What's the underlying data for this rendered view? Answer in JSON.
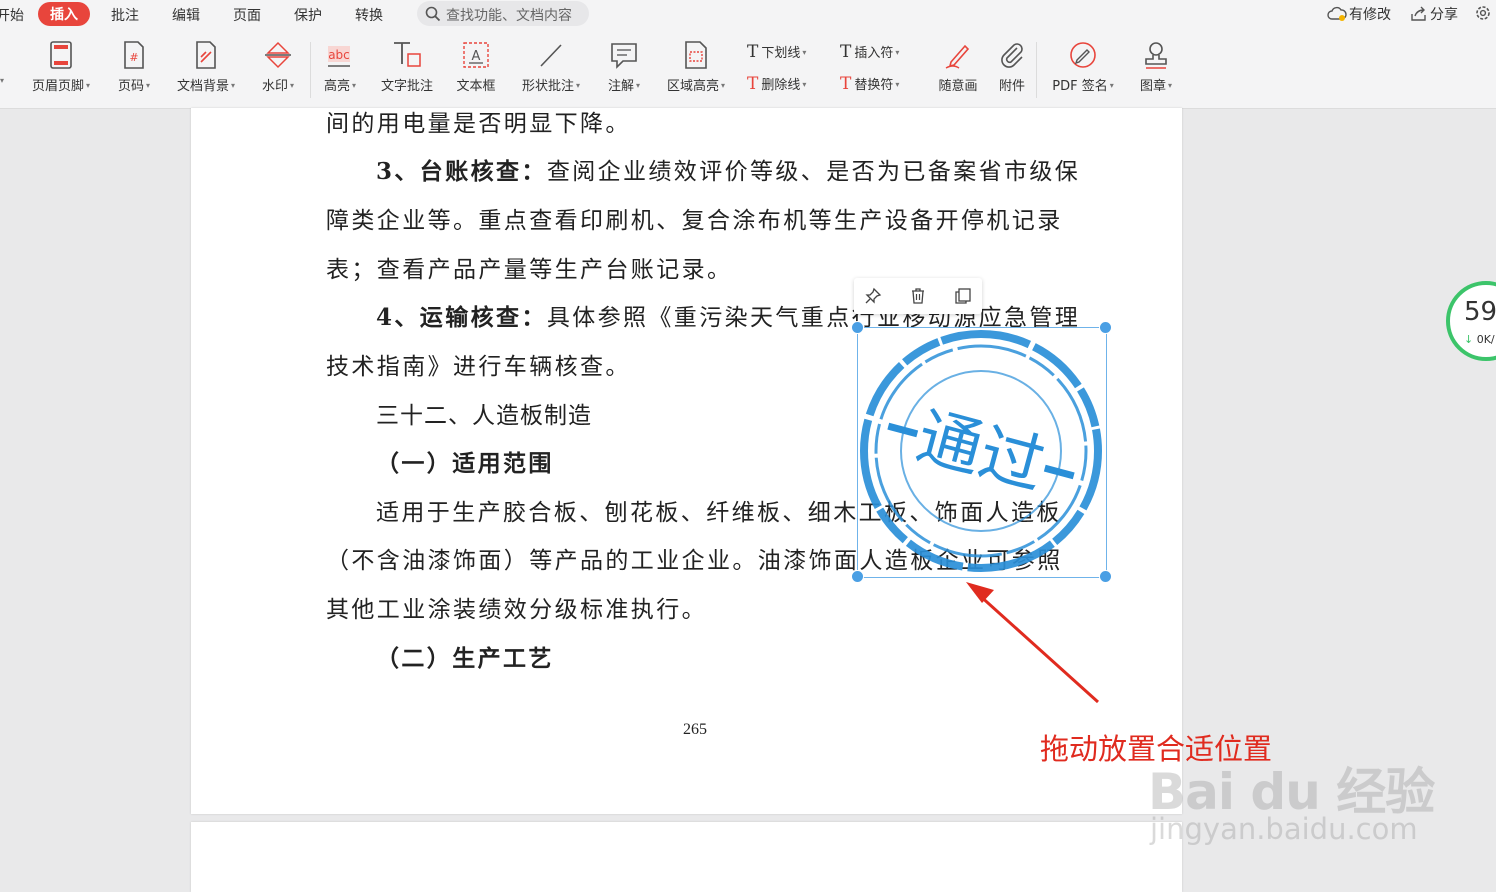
{
  "menu": {
    "items": [
      "开始",
      "插入",
      "批注",
      "编辑",
      "页面",
      "保护",
      "转换"
    ],
    "active": "插入",
    "search_placeholder": "查找功能、文档内容",
    "right": {
      "modified": "有修改",
      "share": "分享"
    }
  },
  "ribbon": {
    "tools": [
      {
        "label": "页眉页脚",
        "icon": "header-footer-icon"
      },
      {
        "label": "页码",
        "icon": "page-number-icon"
      },
      {
        "label": "文档背景",
        "icon": "doc-background-icon"
      },
      {
        "label": "水印",
        "icon": "watermark-icon"
      },
      {
        "label": "高亮",
        "icon": "highlight-icon"
      },
      {
        "label": "文字批注",
        "icon": "text-comment-icon"
      },
      {
        "label": "文本框",
        "icon": "textbox-icon"
      },
      {
        "label": "形状批注",
        "icon": "shape-comment-icon"
      },
      {
        "label": "注解",
        "icon": "annotation-icon"
      },
      {
        "label": "区域高亮",
        "icon": "area-highlight-icon"
      },
      {
        "label": "随意画",
        "icon": "freehand-icon"
      },
      {
        "label": "附件",
        "icon": "attachment-icon"
      },
      {
        "label": "PDF 签名",
        "icon": "pdf-sign-icon"
      },
      {
        "label": "图章",
        "icon": "stamp-icon"
      }
    ],
    "small_tools": {
      "underline": "下划线",
      "strikethrough": "删除线",
      "insert_mark": "插入符",
      "replace_mark": "替换符"
    }
  },
  "document": {
    "lines": {
      "l1": "间的用电量是否明显下降。",
      "l2_bold": "3、台账核查：",
      "l2_rest": "查阅企业绩效评价等级、是否为已备案省市级保",
      "l3": "障类企业等。重点查看印刷机、复合涂布机等生产设备开停机记录",
      "l4": "表；查看产品产量等生产台账记录。",
      "l5_bold": "4、运输核查：",
      "l5_rest": "具体参照《重污染天气重点行业移动源应急管理",
      "l6": "技术指南》进行车辆核查。",
      "l7": "三十二、人造板制造",
      "l8": "（一）适用范围",
      "l9": "适用于生产胶合板、刨花板、纤维板、细木工板、饰面人造板",
      "l10": "（不含油漆饰面）等产品的工业企业。油漆饰面人造板企业可参照",
      "l11": "其他工业涂装绩效分级标准执行。",
      "l12": "（二）生产工艺"
    },
    "page_number": "265"
  },
  "stamp": {
    "text": "通过",
    "color": "#2a8fd8"
  },
  "annotation": {
    "text": "拖动放置合适位置",
    "color": "#e02b1f"
  },
  "speed_widget": {
    "value": "59",
    "sub": "0K/"
  },
  "watermark": {
    "logo": "Bai du 经验",
    "url": "jingyan.baidu.com"
  }
}
